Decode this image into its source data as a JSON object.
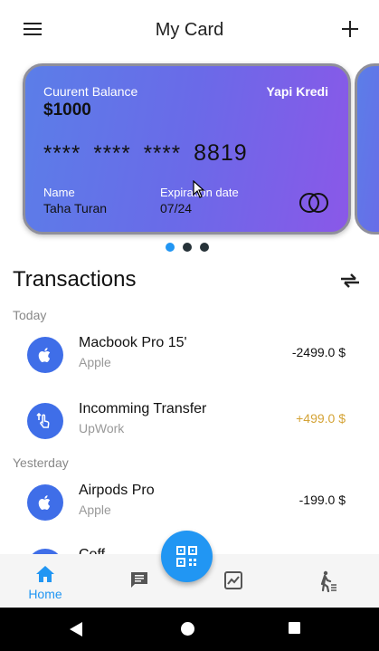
{
  "appbar": {
    "title": "My Card"
  },
  "card": {
    "balance_label": "Cuurent Balance",
    "balance_value": "$1000",
    "bank": "Yapi Kredi",
    "number_masked": [
      "****",
      "****",
      "****"
    ],
    "number_last": "8819",
    "name_label": "Name",
    "name_value": "Taha Turan",
    "exp_label": "Expiration date",
    "exp_value": "07/24",
    "accent": "#6a6ae8"
  },
  "carousel": {
    "active_index": 0,
    "count": 3
  },
  "transactions": {
    "title": "Transactions",
    "groups": [
      {
        "label": "Today",
        "items": [
          {
            "name": "Macbook Pro 15'",
            "sub": "Apple",
            "amount": "-2499.0 $",
            "icon": "apple-icon"
          },
          {
            "name": "Incomming Transfer",
            "sub": "UpWork",
            "amount": "+499.0 $",
            "icon": "transfer-icon"
          }
        ]
      },
      {
        "label": "Yesterday",
        "items": [
          {
            "name": "Airpods Pro",
            "sub": "Apple",
            "amount": "-199.0 $",
            "icon": "apple-icon"
          },
          {
            "name": "Coff",
            "sub": "",
            "amount": "",
            "icon": "coffee-icon"
          }
        ]
      }
    ]
  },
  "bottomnav": {
    "home_label": "Home",
    "accent": "#2196f3"
  }
}
